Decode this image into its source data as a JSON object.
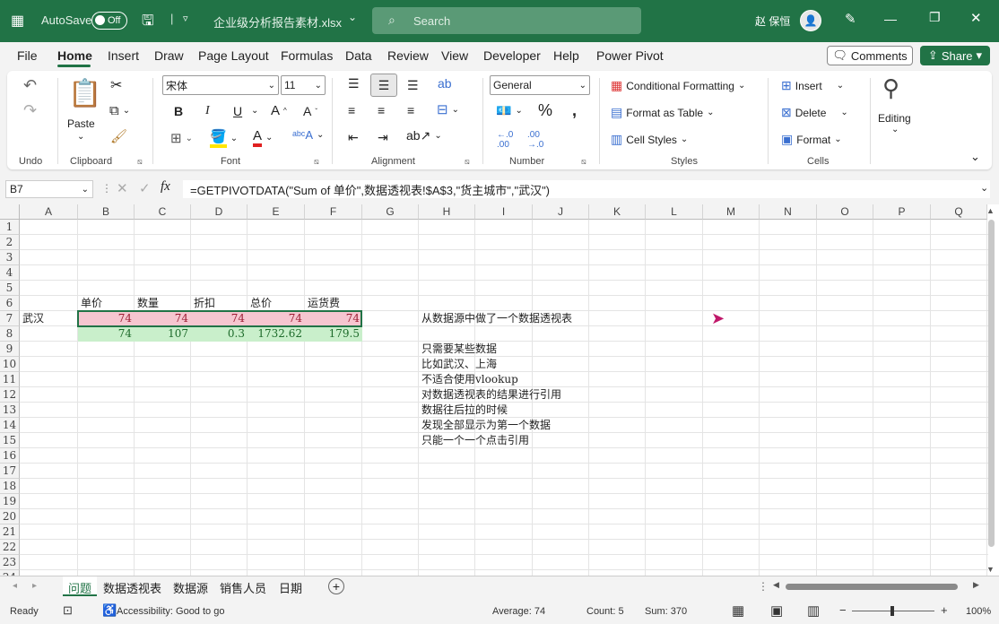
{
  "titlebar": {
    "autosave_label": "AutoSave",
    "autosave_state": "Off",
    "filename": "企业级分析报告素材.xlsx",
    "filename_dropdown": "⌄",
    "search_placeholder": "Search",
    "user_name": "赵 保恒",
    "brand_color": "#217346"
  },
  "menu": {
    "tabs": [
      "File",
      "Home",
      "Insert",
      "Draw",
      "Page Layout",
      "Formulas",
      "Data",
      "Review",
      "View",
      "Developer",
      "Help",
      "Power Pivot"
    ],
    "active_tab": "Home",
    "comments_label": "Comments",
    "share_label": "Share"
  },
  "ribbon": {
    "undo_label": "Undo",
    "paste_label": "Paste",
    "clipboard_label": "Clipboard",
    "font_name": "宋体",
    "font_size": "11",
    "font_label": "Font",
    "bold": "B",
    "italic": "I",
    "underline": "U",
    "alignment_label": "Alignment",
    "number_format": "General",
    "number_label": "Number",
    "conditional_formatting": "Conditional Formatting",
    "format_as_table": "Format as Table",
    "cell_styles": "Cell Styles",
    "styles_label": "Styles",
    "insert_label": "Insert",
    "delete_label": "Delete",
    "format_label": "Format",
    "cells_label": "Cells",
    "editing_label": "Editing"
  },
  "formula_bar": {
    "name_box": "B7",
    "fx": "fx",
    "formula": "=GETPIVOTDATA(\"Sum of 单价\",数据透视表!$A$3,\"货主城市\",\"武汉\")"
  },
  "sheet": {
    "columns": [
      "A",
      "B",
      "C",
      "D",
      "E",
      "F",
      "G",
      "H",
      "I",
      "J",
      "K",
      "L",
      "M",
      "N",
      "O",
      "P",
      "Q"
    ],
    "rows": [
      "1",
      "2",
      "3",
      "4",
      "5",
      "6",
      "7",
      "8",
      "9",
      "10",
      "11",
      "12",
      "13",
      "14",
      "15",
      "16",
      "17",
      "18",
      "19",
      "20",
      "21",
      "22",
      "23",
      "24"
    ],
    "headers_row6": [
      "单价",
      "数量",
      "折扣",
      "总价",
      "运货费"
    ],
    "row7_label": "武汉",
    "row7_values": [
      "74",
      "74",
      "74",
      "74",
      "74"
    ],
    "row8_values": [
      "74",
      "107",
      "0.3",
      "1732.62",
      "179.5"
    ],
    "notes": [
      "从数据源中做了一个数据透视表",
      "只需要某些数据",
      "比如武汉、上海",
      "不适合使用vlookup",
      "对数据透视表的结果进行引用",
      "数据往后拉的时候",
      "发现全部显示为第一个数据",
      "只能一个一个点击引用"
    ],
    "pink_fill": "#f6c6d0",
    "green_fill": "#c9efcb"
  },
  "sheet_tabs": [
    "问题",
    "数据透视表",
    "数据源",
    "销售人员",
    "日期"
  ],
  "active_sheet": "问题",
  "status": {
    "ready": "Ready",
    "accessibility": "Accessibility: Good to go",
    "average": "Average: 74",
    "count": "Count: 5",
    "sum": "Sum: 370",
    "zoom": "100%"
  }
}
